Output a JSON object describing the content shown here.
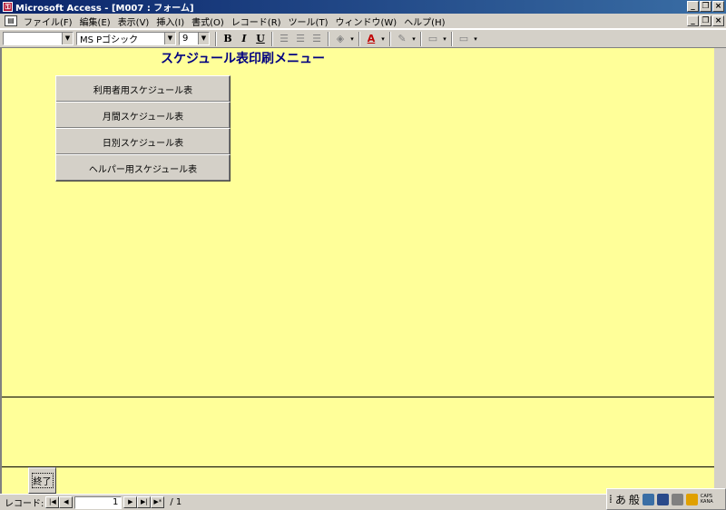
{
  "window": {
    "title": "Microsoft Access - [M007 : フォーム]",
    "app_icon": "access-key-icon",
    "buttons": [
      "minimize-icon",
      "restore-icon",
      "close-icon"
    ]
  },
  "menubar": {
    "items": [
      "ファイル(F)",
      "編集(E)",
      "表示(V)",
      "挿入(I)",
      "書式(O)",
      "レコード(R)",
      "ツール(T)",
      "ウィンドウ(W)",
      "ヘルプ(H)"
    ]
  },
  "toolbar": {
    "object_combo": "",
    "font_combo": "MS Pゴシック",
    "size_combo": "9",
    "bold": "B",
    "italic": "I",
    "underline": "U"
  },
  "form": {
    "background": "#ffff99",
    "title": "スケジュール表印刷メニュー",
    "buttons": [
      {
        "label": "利用者用スケジュール表"
      },
      {
        "label": "月間スケジュール表"
      },
      {
        "label": "日別スケジュール表"
      },
      {
        "label": "ヘルパー用スケジュール表"
      }
    ],
    "exit_label": "終了"
  },
  "status": {
    "record_label": "レコード:",
    "current": "1",
    "total": "/ 1"
  },
  "ime": {
    "mode": "あ",
    "conversion": "般",
    "caps": "CAPS",
    "kana": "KANA"
  }
}
